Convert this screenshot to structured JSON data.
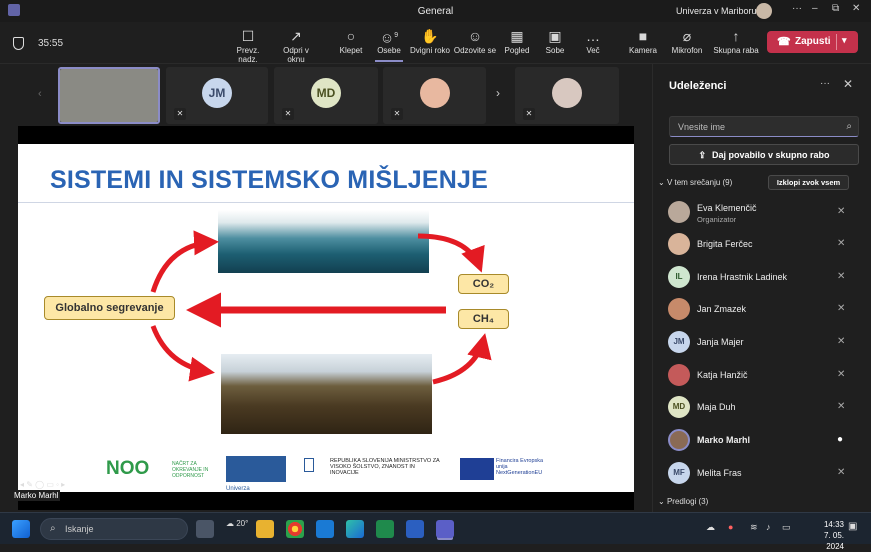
{
  "window": {
    "title": "General",
    "org": "Univerza v Mariboru",
    "controls": [
      "–",
      "⧉",
      "✕"
    ]
  },
  "toolbar": {
    "timer": "35:55",
    "items": [
      {
        "label": "Prevz. nadz.",
        "icon": "take-control-icon",
        "glyph": "☐"
      },
      {
        "label": "Odpri v oknu",
        "icon": "popout-icon",
        "glyph": "↗"
      },
      {
        "label": "Klepet",
        "icon": "chat-icon",
        "glyph": "○"
      },
      {
        "label": "Osebe",
        "icon": "people-icon",
        "glyph": "☺",
        "count": "9"
      },
      {
        "label": "Dvigni roko",
        "icon": "raise-hand-icon",
        "glyph": "✋"
      },
      {
        "label": "Odzovite se",
        "icon": "react-icon",
        "glyph": "☺"
      },
      {
        "label": "Pogled",
        "icon": "view-icon",
        "glyph": "▦"
      },
      {
        "label": "Sobe",
        "icon": "rooms-icon",
        "glyph": "▣"
      },
      {
        "label": "Več",
        "icon": "more-icon",
        "glyph": "…"
      },
      {
        "label": "Kamera",
        "icon": "camera-off-icon",
        "glyph": "■"
      },
      {
        "label": "Mikrofon",
        "icon": "mic-off-icon",
        "glyph": "⌀"
      },
      {
        "label": "Skupna raba",
        "icon": "share-icon",
        "glyph": "↑"
      }
    ],
    "leave_label": "Zapusti"
  },
  "gallery": {
    "tiles": [
      {
        "initials": "",
        "color": "#7a7a7a"
      },
      {
        "initials": "JM",
        "color": "#c7d6ec"
      },
      {
        "initials": "MD",
        "color": "#dfe5c5"
      },
      {
        "initials": "",
        "color": "#e8b8a0"
      },
      {
        "initials": "",
        "color": "#d8c8c0"
      }
    ]
  },
  "slide": {
    "title": "SISTEMI IN SISTEMSKO MIŠLJENJE",
    "box_warming": "Globalno segrevanje",
    "box_co2": "CO₂",
    "box_ch4": "CH₄",
    "logo_noo": "NOO",
    "logo_noo_sub": "NAČRT ZA OKREVANJE IN ODPORNOST",
    "logo_um": "Univerza v Mariboru",
    "logo_ministry": "REPUBLIKA SLOVENIJA MINISTRSTVO ZA VISOKO ŠOLSTVO, ZNANOST IN INOVACIJE",
    "logo_eu": "Financira Evropska unija NextGenerationEU"
  },
  "presenter": {
    "name": "Marko Marhl"
  },
  "panel": {
    "title": "Udeleženci",
    "search_placeholder": "Vnesite ime",
    "invite_label": "Daj povabilo v skupno rabo",
    "in_meeting_label": "V tem srečanju (9)",
    "mute_all_label": "Izklopi zvok vsem",
    "suggested_label": "Predlogi (3)",
    "participants": [
      {
        "name": "Eva Klemenčič",
        "role": "Organizator",
        "initials": "",
        "color": "#b9a89a",
        "mic": "mic-off"
      },
      {
        "name": "Brigita Ferčec",
        "role": "",
        "initials": "",
        "color": "#d9b49a",
        "mic": "mic-off"
      },
      {
        "name": "Irena Hrastnik Ladinek",
        "role": "",
        "initials": "IL",
        "color": "#cfe6cf",
        "mic": "mic-off"
      },
      {
        "name": "Jan Zmazek",
        "role": "",
        "initials": "",
        "color": "#c78a6a",
        "mic": "mic-off"
      },
      {
        "name": "Janja Majer",
        "role": "",
        "initials": "JM",
        "color": "#c7d6ec",
        "mic": "mic-off"
      },
      {
        "name": "Katja Hanžič",
        "role": "",
        "initials": "",
        "color": "#c45a5a",
        "mic": "mic-off"
      },
      {
        "name": "Maja Duh",
        "role": "",
        "initials": "MD",
        "color": "#dfe5c5",
        "mic": "mic-off"
      },
      {
        "name": "Marko Marhl",
        "role": "",
        "initials": "",
        "color": "#8a6a55",
        "mic": "mic-on"
      },
      {
        "name": "Melita Fras",
        "role": "",
        "initials": "MF",
        "color": "#c7d6ec",
        "mic": "mic-off"
      }
    ]
  },
  "taskbar": {
    "search_label": "Iskanje",
    "weather": "20°",
    "time": "14:33",
    "date": "7. 05. 2024"
  }
}
